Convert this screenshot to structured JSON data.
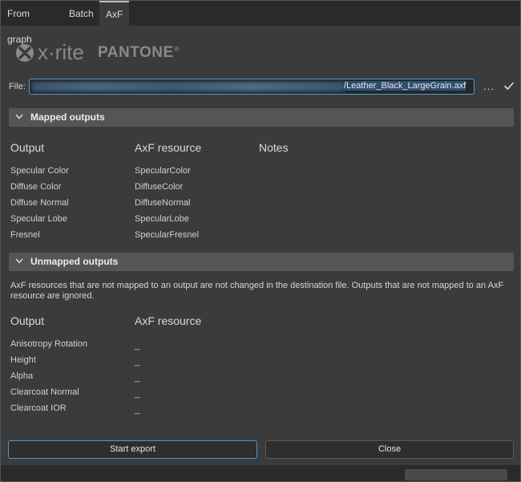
{
  "tabs": [
    {
      "label": "From graph"
    },
    {
      "label": "Batch"
    },
    {
      "label": "AxF"
    }
  ],
  "logos": {
    "xrite": "x·rite",
    "pantone": "PANTONE",
    "pantone_mark": "®"
  },
  "file": {
    "label": "File:",
    "path_visible": "/Leather_Black_LargeGrain.axf",
    "more_label": "...",
    "confirm_icon": "checkmark-icon"
  },
  "mapped": {
    "title": "Mapped outputs",
    "headers": {
      "output": "Output",
      "resource": "AxF resource",
      "notes": "Notes"
    },
    "rows": [
      {
        "output": "Specular Color",
        "resource": "SpecularColor"
      },
      {
        "output": "Diffuse Color",
        "resource": "DiffuseColor"
      },
      {
        "output": "Diffuse Normal",
        "resource": "DiffuseNormal"
      },
      {
        "output": "Specular Lobe",
        "resource": "SpecularLobe"
      },
      {
        "output": "Fresnel",
        "resource": "SpecularFresnel"
      }
    ]
  },
  "unmapped": {
    "title": "Unmapped outputs",
    "note": "AxF resources that are not mapped to an output are not changed in the destination file. Outputs that are not mapped to an AxF resource are ignored.",
    "headers": {
      "output": "Output",
      "resource": "AxF resource"
    },
    "rows": [
      {
        "output": "Anisotropy Rotation",
        "resource": "_"
      },
      {
        "output": "Height",
        "resource": "_"
      },
      {
        "output": "Alpha",
        "resource": "_"
      },
      {
        "output": "Clearcoat Normal",
        "resource": "_"
      },
      {
        "output": "Clearcoat IOR",
        "resource": "_"
      }
    ]
  },
  "buttons": {
    "start_export": "Start export",
    "close": "Close"
  },
  "colors": {
    "accent": "#4a9ad8",
    "section_bg": "#555555",
    "panel_bg": "#3b3b3b"
  }
}
